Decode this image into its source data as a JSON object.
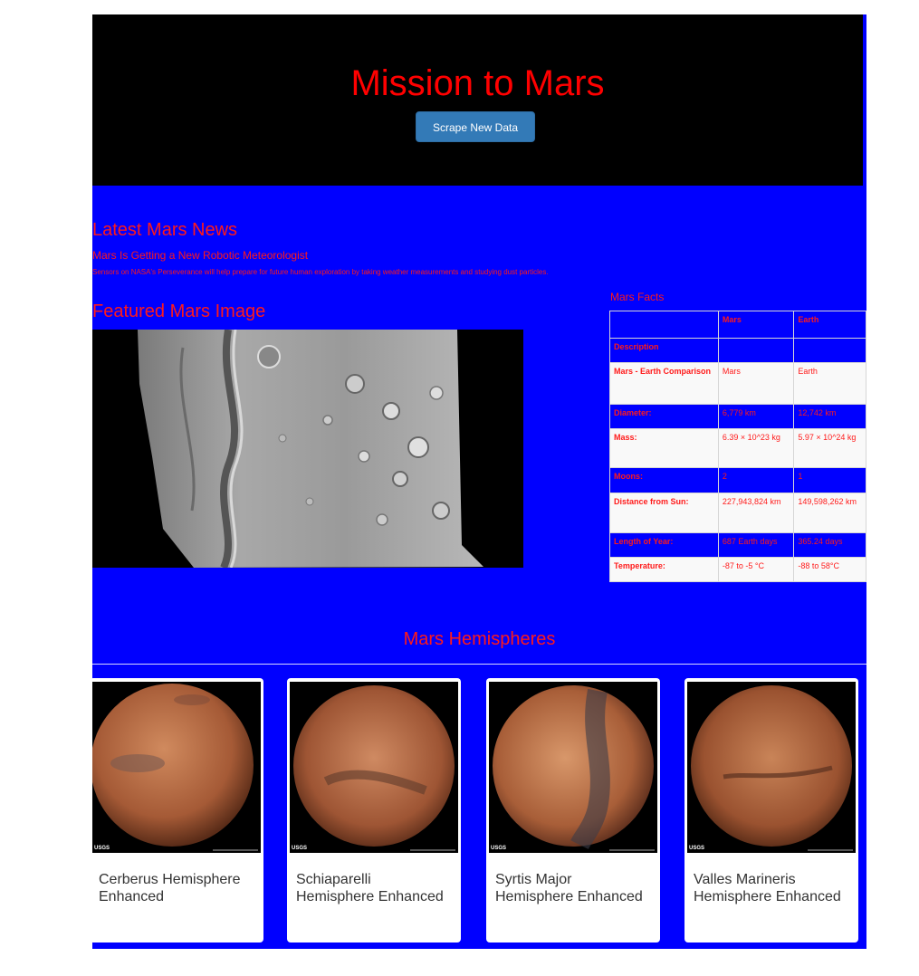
{
  "header": {
    "title": "Mission to Mars",
    "scrape_button": "Scrape New Data"
  },
  "news": {
    "heading": "Latest Mars News",
    "title": "Mars Is Getting a New Robotic Meteorologist",
    "paragraph": "Sensors on NASA's Perseverance will help prepare for future human exploration by taking weather measurements and studying dust particles."
  },
  "featured_image": {
    "heading": "Featured Mars Image"
  },
  "facts": {
    "heading": "Mars Facts",
    "columns": [
      "",
      "Mars",
      "Earth"
    ],
    "rows": [
      [
        "Description",
        "",
        ""
      ],
      [
        "Mars - Earth Comparison",
        "Mars",
        "Earth"
      ],
      [
        "Diameter:",
        "6,779 km",
        "12,742 km"
      ],
      [
        "Mass:",
        "6.39 × 10^23 kg",
        "5.97 × 10^24 kg"
      ],
      [
        "Moons:",
        "2",
        "1"
      ],
      [
        "Distance from Sun:",
        "227,943,824 km",
        "149,598,262 km"
      ],
      [
        "Length of Year:",
        "687 Earth days",
        "365.24 days"
      ],
      [
        "Temperature:",
        "-87 to -5 °C",
        "-88 to 58°C"
      ]
    ]
  },
  "hemispheres": {
    "heading": "Mars Hemispheres",
    "items": [
      {
        "title": "Cerberus Hemisphere Enhanced",
        "watermark": "USGS"
      },
      {
        "title": "Schiaparelli Hemisphere Enhanced",
        "watermark": "USGS"
      },
      {
        "title": "Syrtis Major Hemisphere Enhanced",
        "watermark": "USGS"
      },
      {
        "title": "Valles Marineris Hemisphere Enhanced",
        "watermark": "USGS"
      }
    ]
  },
  "colors": {
    "page_background": "#0000ff",
    "header_background": "#000000",
    "accent_text": "#ff0000",
    "button": "#337ab7"
  }
}
